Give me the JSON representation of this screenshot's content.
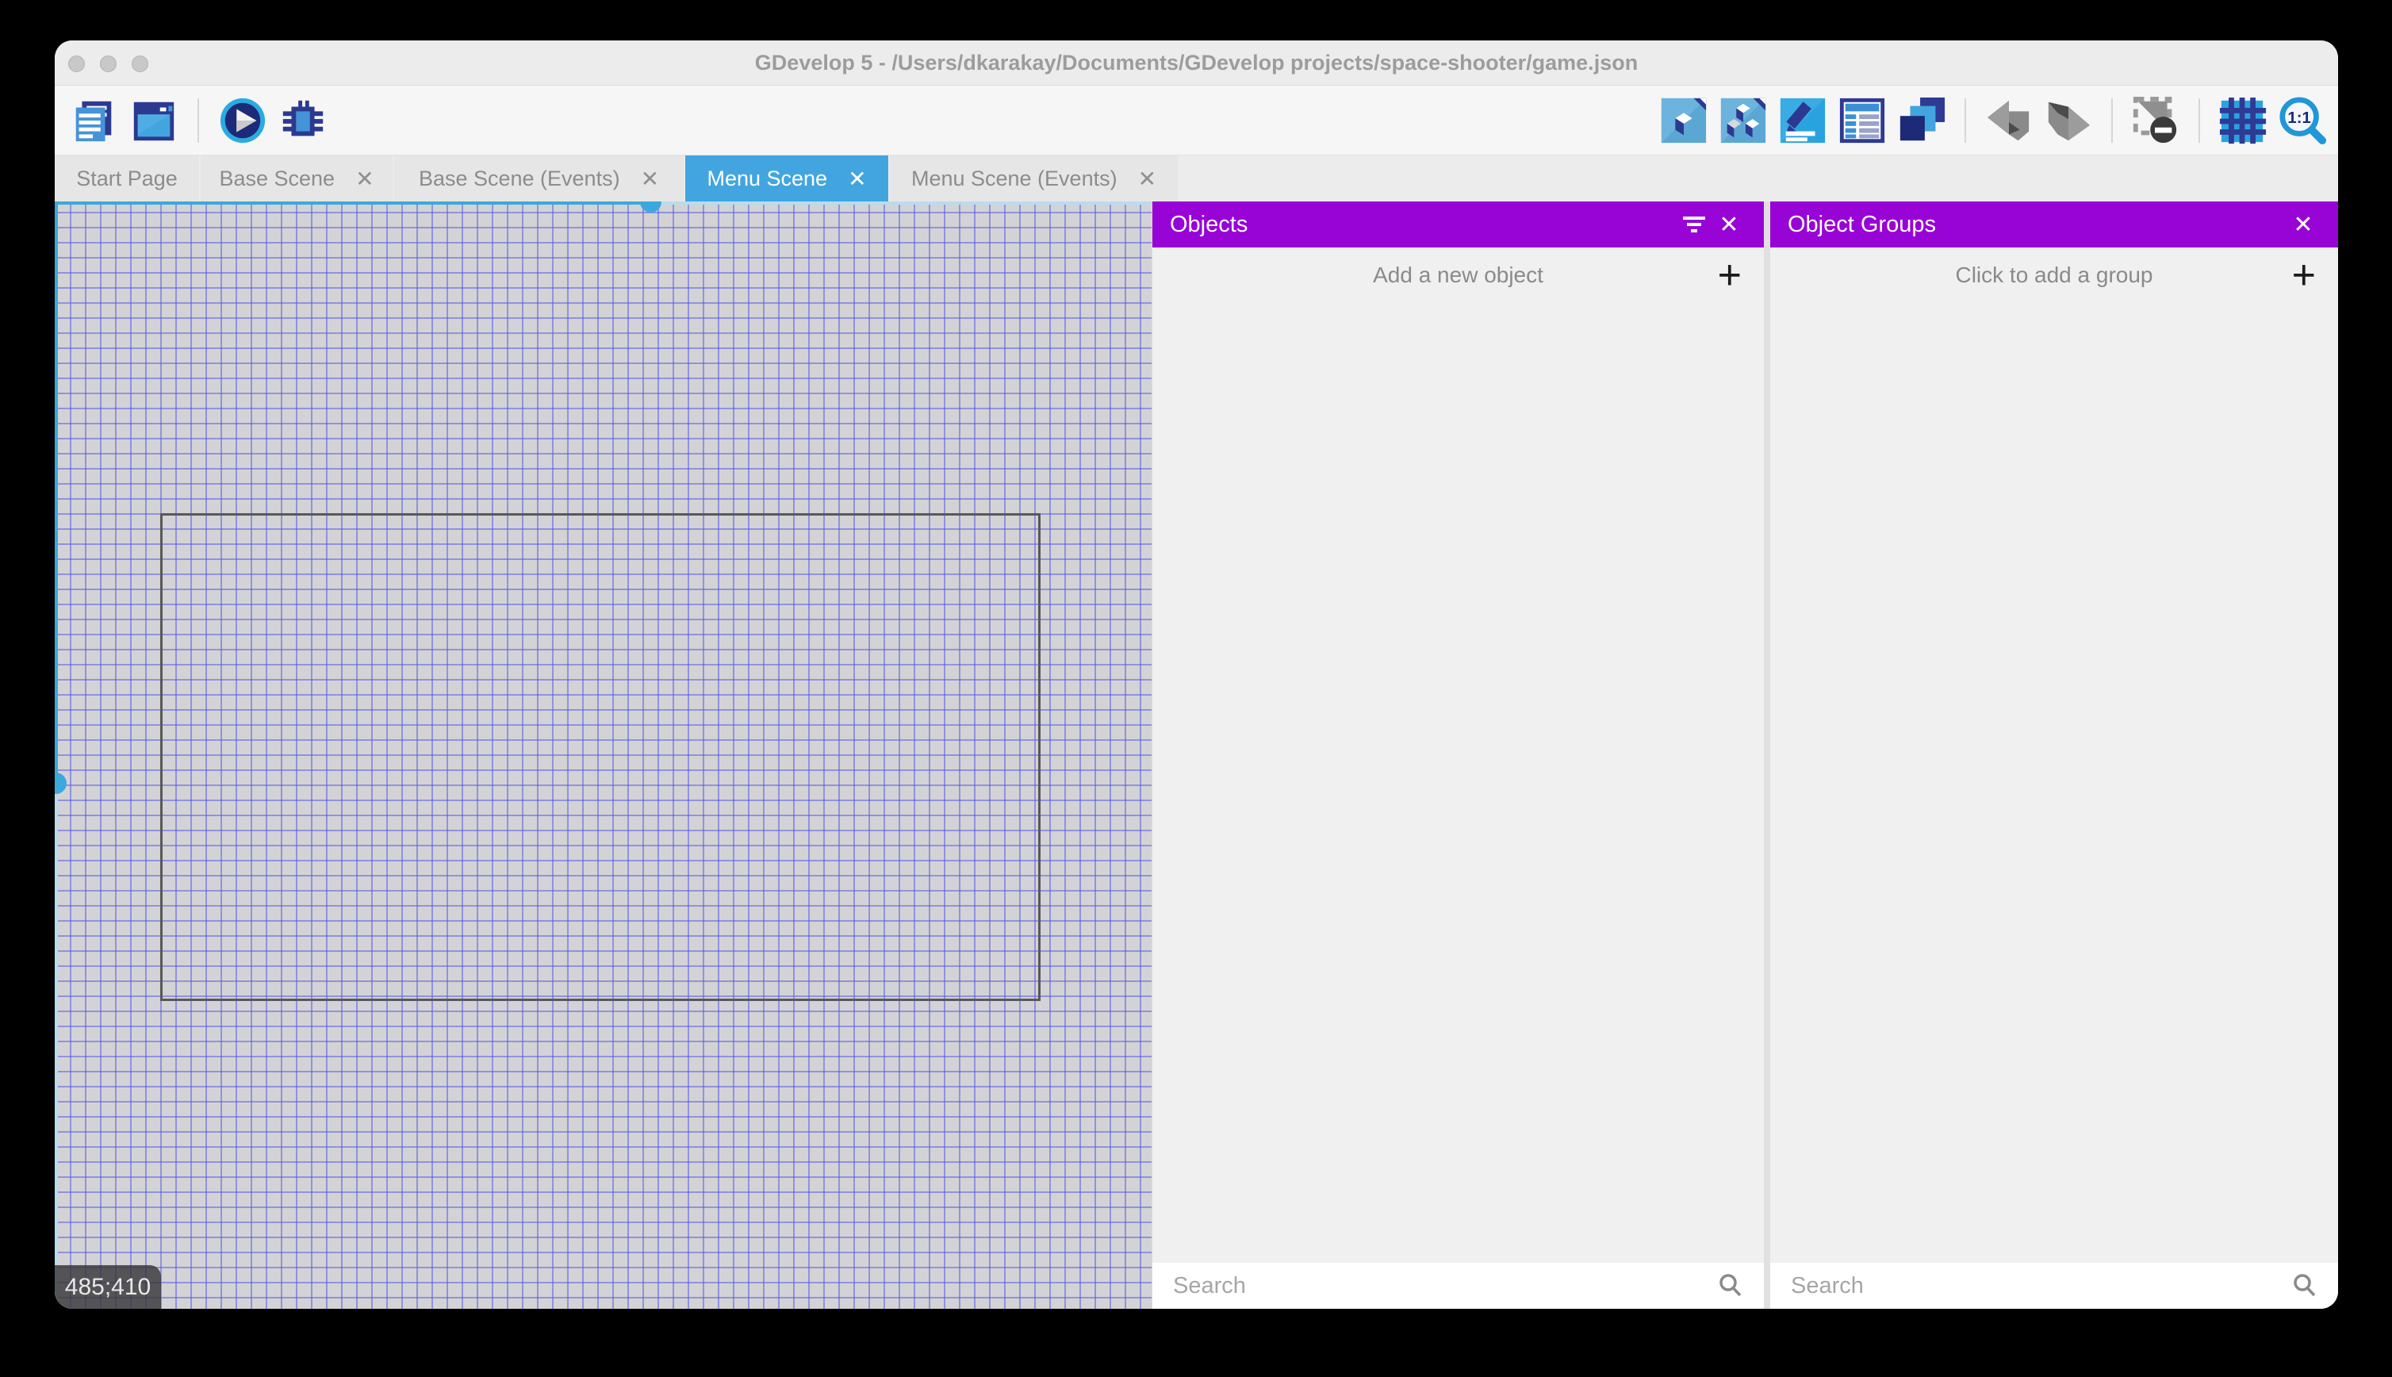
{
  "window": {
    "title": "GDevelop 5 - /Users/dkarakay/Documents/GDevelop projects/space-shooter/game.json"
  },
  "toolbar": {
    "left_icons": [
      "project-manager-icon",
      "start-page-icon",
      "preview-play-icon",
      "debug-icon"
    ],
    "right_icons": [
      "objects-editor-icon",
      "object-groups-editor-icon",
      "properties-icon",
      "instances-list-icon",
      "layers-icon",
      "undo-icon",
      "redo-icon",
      "mask-toggle-icon",
      "grid-toggle-icon",
      "zoom-1-1-icon"
    ],
    "zoom_label": "1:1"
  },
  "tabs": [
    {
      "label": "Start Page",
      "closable": false,
      "active": false
    },
    {
      "label": "Base Scene",
      "closable": true,
      "active": false
    },
    {
      "label": "Base Scene (Events)",
      "closable": true,
      "active": false
    },
    {
      "label": "Menu Scene",
      "closable": true,
      "active": true
    },
    {
      "label": "Menu Scene (Events)",
      "closable": true,
      "active": false
    }
  ],
  "glyphs": {
    "close": "✕",
    "plus": "+"
  },
  "canvas": {
    "coordinates": "485;410"
  },
  "panels": {
    "objects": {
      "title": "Objects",
      "add_label": "Add a new object",
      "search_placeholder": "Search",
      "header_icons": [
        "filter-icon",
        "close-icon"
      ]
    },
    "object_groups": {
      "title": "Object Groups",
      "add_label": "Click to add a group",
      "search_placeholder": "Search",
      "header_icons": [
        "close-icon"
      ]
    }
  },
  "colors": {
    "header_purple": "#9803d6",
    "active_tab_blue": "#42a5e0",
    "scrollbar_blue": "#3da8dc",
    "scrollbar_track": "#b9dcee",
    "grid_bg": "#d3d3d5",
    "grid_line": "#5a5ce6",
    "icon_navy": "#2b3990",
    "icon_blue": "#29abe2"
  }
}
